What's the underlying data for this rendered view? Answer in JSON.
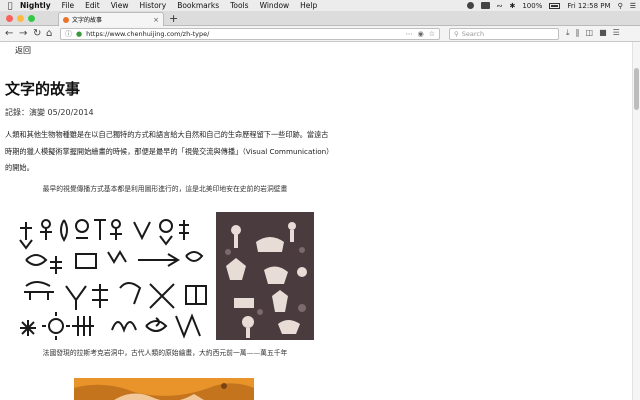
{
  "menubar": {
    "app_name": "Nightly",
    "items": [
      "File",
      "Edit",
      "View",
      "History",
      "Bookmarks",
      "Tools",
      "Window",
      "Help"
    ],
    "battery": "100%",
    "clock": "Fri 12:58 PM"
  },
  "tab": {
    "title": "文字的故事",
    "new_tab": "+"
  },
  "navbar": {
    "url": "https://www.chenhuijing.com/zh-type/",
    "search_placeholder": "Search"
  },
  "page": {
    "back_link": "返回",
    "title": "文字的故事",
    "meta": "記錄：演變 05/20/2014",
    "intro": "人類和其他生物物種雖是在以自己獨特的方式和語言給大自然和自己的生命歷程留下一些印跡。當遠古時期的獵人模擬術掌握開始繪畫的時候，那便是最早的「視覺交流與傳播」（Visual Communication）的開始。",
    "caption1": "最早的視覺傳播方式基本都是利用圖形進行的，這是北美印地安在史前的岩洞壁畫",
    "caption2": "法國發現的拉斯考克岩洞中，古代人類的原始繪畫，大約西元前一萬——萬五千年"
  },
  "colors": {
    "accent_orange": "#e8942a",
    "rock_art_bg": "#4a3b3f"
  }
}
